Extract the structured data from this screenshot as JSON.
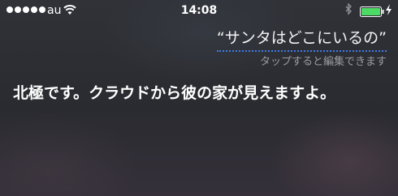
{
  "status_bar": {
    "carrier": "au",
    "time": "14:08",
    "signal_bars": 5,
    "battery_level": 1.0,
    "battery_color": "#4cd964"
  },
  "siri": {
    "query": "“サンタはどこにいるの”",
    "edit_hint": "タップすると編集できます",
    "answer": "北極です。クラウドから彼の家が見えますよ。",
    "underline_color": "#3c7be6"
  },
  "icons": [
    "signal-dots-icon",
    "wifi-icon",
    "bluetooth-icon",
    "battery-icon",
    "charging-bolt-icon"
  ]
}
